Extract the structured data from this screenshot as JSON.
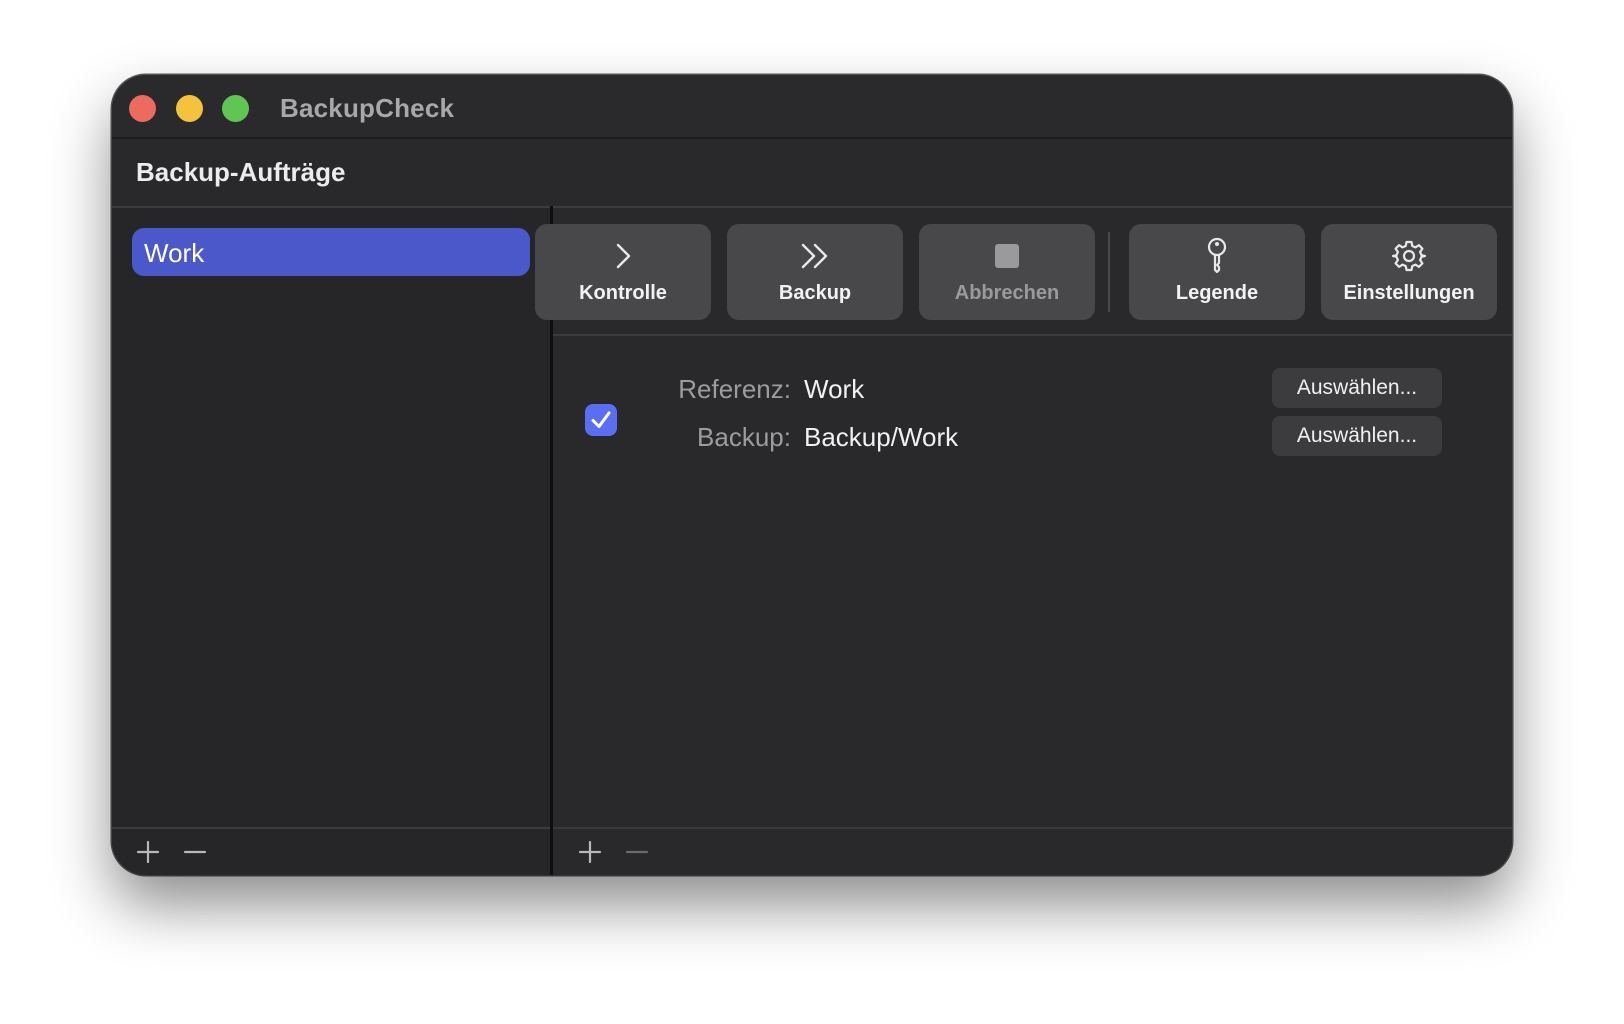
{
  "window": {
    "title": "BackupCheck",
    "section_title": "Backup-Aufträge"
  },
  "sidebar": {
    "items": [
      {
        "label": "Work",
        "selected": true
      }
    ]
  },
  "toolbar": {
    "buttons": [
      {
        "label": "Kontrolle",
        "icon": "chevron-right-icon",
        "enabled": true
      },
      {
        "label": "Backup",
        "icon": "double-chevron-right-icon",
        "enabled": true
      },
      {
        "label": "Abbrechen",
        "icon": "stop-icon",
        "enabled": false
      },
      {
        "label": "Legende",
        "icon": "key-icon",
        "enabled": true
      },
      {
        "label": "Einstellungen",
        "icon": "gear-icon",
        "enabled": true
      }
    ]
  },
  "job": {
    "enabled": true,
    "reference_label": "Referenz:",
    "reference_value": "Work",
    "backup_label": "Backup:",
    "backup_value": "Backup/Work",
    "choose_label": "Auswählen..."
  },
  "colors": {
    "accent": "#4a58c9",
    "checkbox": "#5b6ef2",
    "window_bg": "#29292b"
  }
}
